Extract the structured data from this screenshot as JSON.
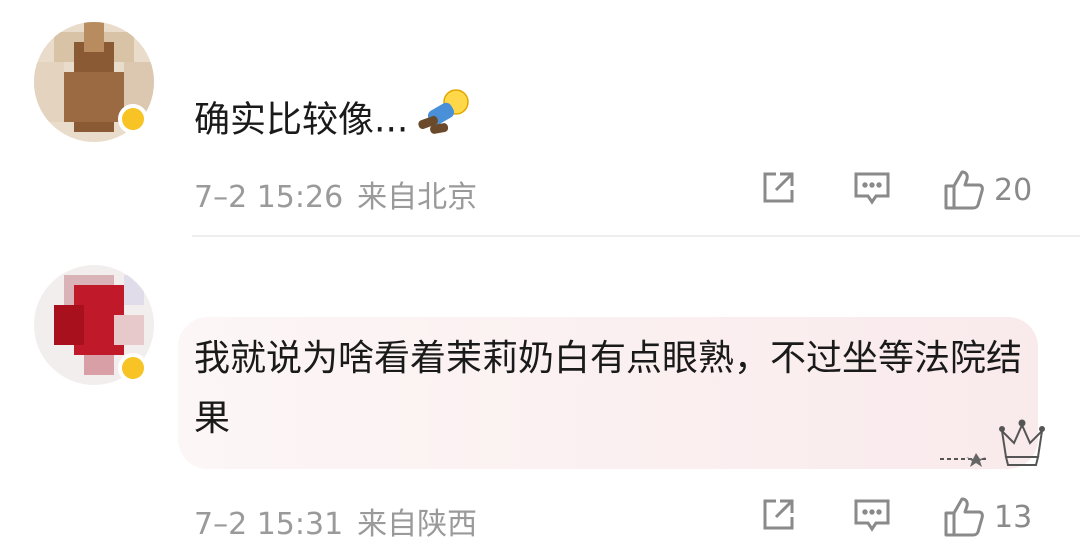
{
  "comments": [
    {
      "text": "确实比较像...",
      "time": "7–2 15:26",
      "location": "来自北京",
      "likes": "20"
    },
    {
      "text": "我就说为啥看着茉莉奶白有点眼熟，不过坐等法院结果",
      "time": "7–2 15:31",
      "location": "来自陕西",
      "likes": "13"
    }
  ],
  "icons": {
    "share": "share-icon",
    "reply": "comment-icon",
    "like": "thumbs-up-icon",
    "verified": "verified-badge-icon",
    "emoji": "sleeping-emoji-icon",
    "decoration": "crown-decoration-icon"
  },
  "colors": {
    "text": "#1a1a1a",
    "meta": "#9a9a9a",
    "badge": "#f7c325",
    "bubble": "#fbeff0"
  }
}
